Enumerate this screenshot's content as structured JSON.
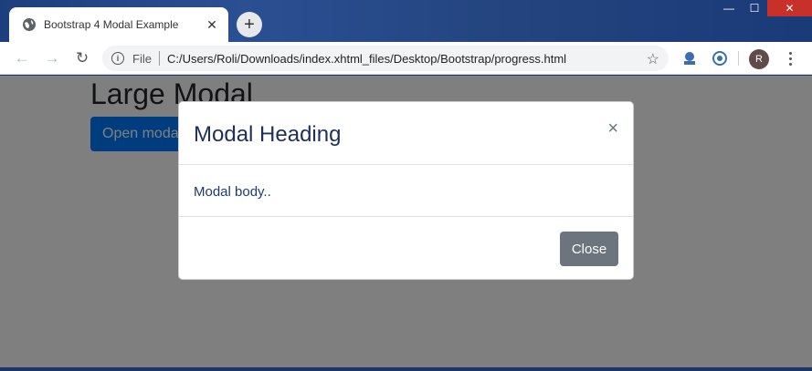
{
  "browser": {
    "tab_title": "Bootstrap 4 Modal Example",
    "tab_close": "✕",
    "new_tab": "+",
    "window_controls": {
      "minimize": "—",
      "maximize": "☐",
      "close": "✕"
    },
    "toolbar": {
      "back": "←",
      "forward": "→",
      "reload": "↻",
      "info": "i",
      "scheme": "File",
      "url": "C:/Users/Roli/Downloads/index.xhtml_files/Desktop/Bootstrap/progress.html",
      "bookmark": "☆",
      "profile_initial": "R"
    }
  },
  "page": {
    "heading": "Large Modal",
    "open_button": "Open modal"
  },
  "modal": {
    "title": "Modal Heading",
    "close_x": "×",
    "body": "Modal body..",
    "footer_button": "Close"
  },
  "colors": {
    "primary": "#007bff",
    "secondary": "#6c757d",
    "window_close": "#c7312a"
  }
}
